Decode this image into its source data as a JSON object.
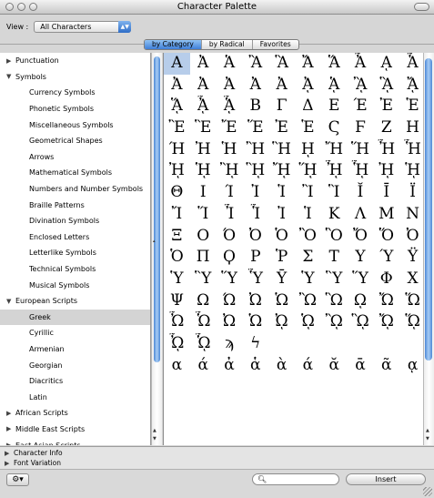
{
  "window": {
    "title": "Character Palette"
  },
  "view": {
    "label": "View :",
    "value": "All Characters"
  },
  "tabs": [
    {
      "label": "by Category",
      "selected": true
    },
    {
      "label": "by Radical",
      "selected": false
    },
    {
      "label": "Favorites",
      "selected": false
    }
  ],
  "tree": [
    {
      "label": "Punctuation",
      "level": 0,
      "expanded": false,
      "selected": false
    },
    {
      "label": "Symbols",
      "level": 0,
      "expanded": true,
      "selected": false
    },
    {
      "label": "Currency Symbols",
      "level": 1,
      "selected": false
    },
    {
      "label": "Phonetic Symbols",
      "level": 1,
      "selected": false
    },
    {
      "label": "Miscellaneous Symbols",
      "level": 1,
      "selected": false
    },
    {
      "label": "Geometrical Shapes",
      "level": 1,
      "selected": false
    },
    {
      "label": "Arrows",
      "level": 1,
      "selected": false
    },
    {
      "label": "Mathematical Symbols",
      "level": 1,
      "selected": false
    },
    {
      "label": "Numbers and Number Symbols",
      "level": 1,
      "selected": false
    },
    {
      "label": "Braille Patterns",
      "level": 1,
      "selected": false
    },
    {
      "label": "Divination Symbols",
      "level": 1,
      "selected": false
    },
    {
      "label": "Enclosed Letters",
      "level": 1,
      "selected": false
    },
    {
      "label": "Letterlike Symbols",
      "level": 1,
      "selected": false
    },
    {
      "label": "Technical Symbols",
      "level": 1,
      "selected": false
    },
    {
      "label": "Musical Symbols",
      "level": 1,
      "selected": false
    },
    {
      "label": "European Scripts",
      "level": 0,
      "expanded": true,
      "selected": false
    },
    {
      "label": "Greek",
      "level": 1,
      "selected": true
    },
    {
      "label": "Cyrillic",
      "level": 1,
      "selected": false
    },
    {
      "label": "Armenian",
      "level": 1,
      "selected": false
    },
    {
      "label": "Georgian",
      "level": 1,
      "selected": false
    },
    {
      "label": "Diacritics",
      "level": 1,
      "selected": false
    },
    {
      "label": "Latin",
      "level": 1,
      "selected": false
    },
    {
      "label": "African Scripts",
      "level": 0,
      "expanded": false,
      "selected": false
    },
    {
      "label": "Middle East Scripts",
      "level": 0,
      "expanded": false,
      "selected": false
    },
    {
      "label": "East Asian Scripts",
      "level": 0,
      "expanded": false,
      "selected": false
    }
  ],
  "characters": [
    [
      "Α",
      "Ἀ",
      "Ἁ",
      "Ἂ",
      "Ἃ",
      "Ἄ",
      "Ἅ",
      "Ἆ",
      "ᾼ",
      "Ἇ"
    ],
    [
      "Ἀ",
      "Ἀ",
      "Ἀ",
      "Ἀ",
      "Ἀ",
      "ᾈ",
      "ᾉ",
      "ᾊ",
      "ᾋ",
      "ᾌ"
    ],
    [
      "ᾍ",
      "ᾎ",
      "ᾏ",
      "Β",
      "Γ",
      "Δ",
      "Ε",
      "Έ",
      "Ἐ",
      "Ἑ"
    ],
    [
      "Ἒ",
      "Ἓ",
      "Ἔ",
      "Ἕ",
      "Ἐ",
      "Ἑ",
      "Ϛ",
      "Ϝ",
      "Ζ",
      "Η"
    ],
    [
      "Ή",
      "Ἠ",
      "Ἡ",
      "Ἢ",
      "Ἣ",
      "ῌ",
      "Ἤ",
      "Ἥ",
      "Ἦ",
      "Ἧ"
    ],
    [
      "ᾘ",
      "ᾙ",
      "ᾚ",
      "ᾛ",
      "ᾜ",
      "ᾝ",
      "ᾞ",
      "ᾟ",
      "ᾘ",
      "ᾙ"
    ],
    [
      "Θ",
      "Ι",
      "Ί",
      "Ἰ",
      "Ἱ",
      "Ἲ",
      "Ἳ",
      "Ῐ",
      "Ῑ",
      "Ϊ"
    ],
    [
      "Ἴ",
      "Ἵ",
      "Ἶ",
      "Ἷ",
      "Ἰ",
      "Ἱ",
      "Κ",
      "Λ",
      "Μ",
      "Ν"
    ],
    [
      "Ξ",
      "Ο",
      "Ό",
      "Ὀ",
      "Ὁ",
      "Ὂ",
      "Ὃ",
      "Ὄ",
      "Ὅ",
      "Ὀ"
    ],
    [
      "Ὁ",
      "Π",
      "Ϙ",
      "Ρ",
      "Ῥ",
      "Σ",
      "Τ",
      "Υ",
      "Ύ",
      "Ϋ"
    ],
    [
      "Ὑ",
      "Ὓ",
      "Ὕ",
      "Ὗ",
      "Ῡ",
      "Ὑ",
      "Ὓ",
      "Ὕ",
      "Φ",
      "Χ"
    ],
    [
      "Ψ",
      "Ω",
      "Ώ",
      "Ὠ",
      "Ὡ",
      "Ὢ",
      "Ὣ",
      "ῼ",
      "Ὤ",
      "Ὥ"
    ],
    [
      "Ὦ",
      "Ὧ",
      "Ὠ",
      "Ὡ",
      "ᾨ",
      "ᾩ",
      "ᾪ",
      "ᾫ",
      "ᾬ",
      "ᾭ"
    ],
    [
      "ᾮ",
      "ᾯ",
      "ϡ",
      "ϟ",
      "",
      "",
      "",
      "",
      "",
      ""
    ],
    [
      "α",
      "ά",
      "ἀ",
      "ἁ",
      "ὰ",
      "ά",
      "ᾰ",
      "ᾱ",
      "ᾶ",
      "ᾳ"
    ]
  ],
  "footer": {
    "character_info": "Character Info",
    "font_variation": "Font Variation",
    "search_value": "",
    "insert_label": "Insert"
  }
}
